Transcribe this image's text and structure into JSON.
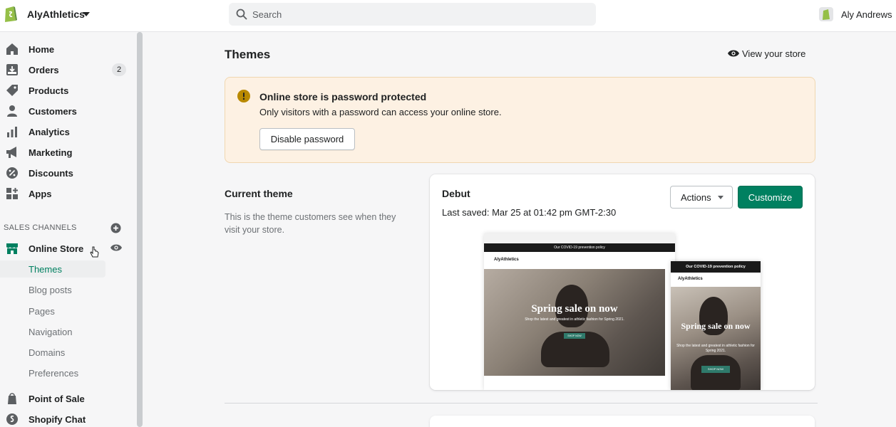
{
  "topbar": {
    "store_name": "AlyAthletics",
    "search_placeholder": "Search",
    "user_name": "Aly Andrews"
  },
  "sidebar": {
    "items": [
      {
        "label": "Home",
        "icon": "home-icon"
      },
      {
        "label": "Orders",
        "icon": "orders-icon",
        "badge": "2"
      },
      {
        "label": "Products",
        "icon": "tag-icon"
      },
      {
        "label": "Customers",
        "icon": "person-icon"
      },
      {
        "label": "Analytics",
        "icon": "bar-chart-icon"
      },
      {
        "label": "Marketing",
        "icon": "megaphone-icon"
      },
      {
        "label": "Discounts",
        "icon": "discount-icon"
      },
      {
        "label": "Apps",
        "icon": "apps-icon"
      }
    ],
    "sales_channels_header": "SALES CHANNELS",
    "online_store": "Online Store",
    "sub_items": [
      "Themes",
      "Blog posts",
      "Pages",
      "Navigation",
      "Domains",
      "Preferences"
    ],
    "point_of_sale": "Point of Sale",
    "shopify_chat": "Shopify Chat"
  },
  "main": {
    "title": "Themes",
    "view_store": "View your store",
    "banner": {
      "title": "Online store is password protected",
      "text": "Only visitors with a password can access your online store.",
      "button": "Disable password"
    },
    "current_theme": {
      "title": "Current theme",
      "description": "This is the theme customers see when they visit your store."
    },
    "theme_card": {
      "name": "Debut",
      "last_saved": "Last saved: Mar 25 at 01:42 pm GMT-2:30",
      "actions": "Actions",
      "customize": "Customize"
    },
    "preview": {
      "desktop_announcement": "Our COVID-19 prevention policy",
      "desktop_logo": "AlyAthletics",
      "desktop_hero_title": "Spring sale on now",
      "desktop_hero_sub": "Shop the latest and greatest in athletic fashion for Spring 2021.",
      "desktop_hero_button": "SHOP NOW",
      "mobile_announcement": "Our COVID-19 prevention policy",
      "mobile_logo": "AlyAthletics",
      "mobile_hero_title": "Spring sale on now",
      "mobile_hero_sub": "Shop the latest and greatest in athletic fashion for Spring 2021.",
      "mobile_hero_button": "SHOP NOW"
    }
  },
  "colors": {
    "accent": "#008060",
    "banner_bg": "#fdf1e3",
    "warning_icon": "#b98900"
  }
}
